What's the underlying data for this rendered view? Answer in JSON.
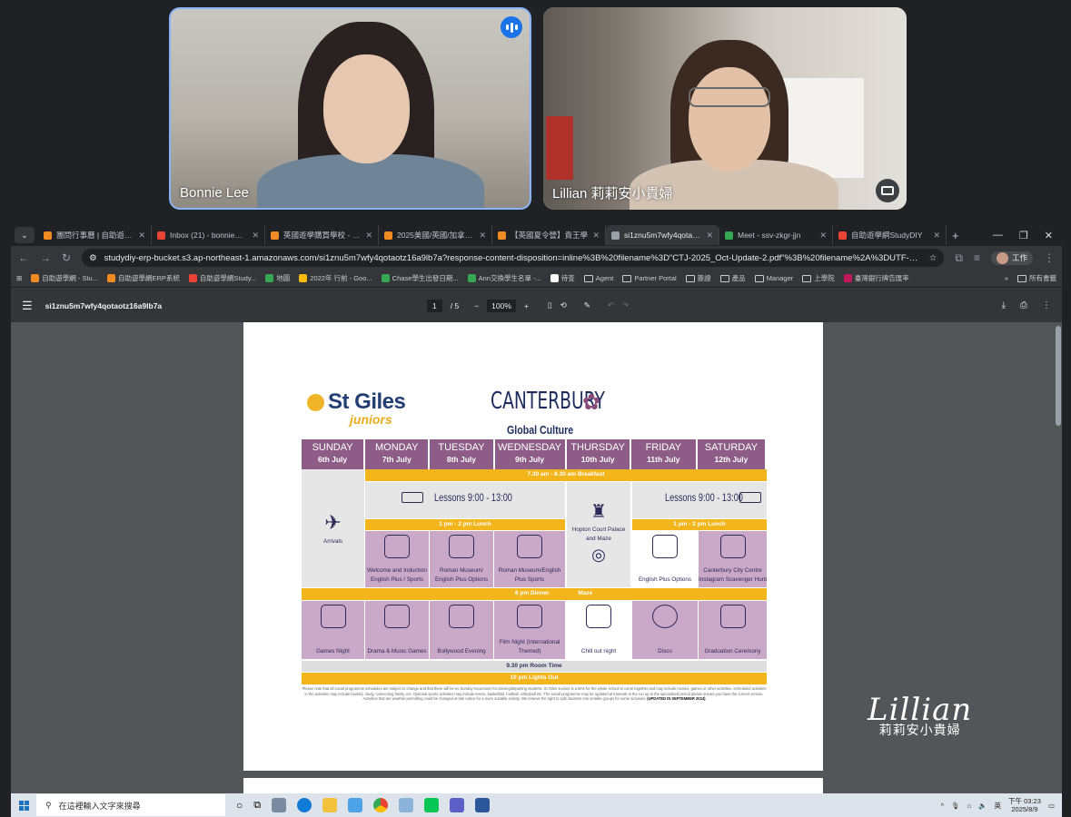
{
  "meeting": {
    "participants": [
      {
        "name": "Bonnie Lee"
      },
      {
        "name": "Lillian 莉莉安小貴婦"
      }
    ]
  },
  "browser": {
    "tabs": [
      {
        "label": "團問行事曆 | 自助遊學網",
        "color": "#f28b22"
      },
      {
        "label": "Inbox (21) - bonnie@stu",
        "color": "#ea4335"
      },
      {
        "label": "英國遊學購買學校 - Study",
        "color": "#f28b22"
      },
      {
        "label": "2025美國/英國/加拿大/遊",
        "color": "#f28b22"
      },
      {
        "label": "【英國夏令營】貴王學",
        "color": "#f28b22"
      },
      {
        "label": "si1znu5m7wfy4qotaotz",
        "color": "#9aa0a6",
        "active": true
      },
      {
        "label": "Meet - ssv-zkgr-jjn",
        "color": "#34a853"
      },
      {
        "label": "自助遊學網StudyDIY",
        "color": "#ea4335"
      }
    ],
    "url": "studydiy-erp-bucket.s3.ap-northeast-1.amazonaws.com/si1znu5m7wfy4qotaotz16a9lb7a?response-content-disposition=inline%3B%20filename%3D\"CTJ-2025_Oct-Update-2.pdf\"%3B%20filename%2A%3DUTF-8%27%27CTJ-2...",
    "profile_label": "工作",
    "bookmarks": [
      {
        "label": "自助遊學網 - Stu...",
        "kind": "site",
        "color": "#f28b22"
      },
      {
        "label": "自助遊學網ERP系統",
        "kind": "site",
        "color": "#f28b22"
      },
      {
        "label": "自助遊學網Study...",
        "kind": "site",
        "color": "#ea4335"
      },
      {
        "label": "地圖",
        "kind": "site",
        "color": "#34a853"
      },
      {
        "label": "2022年 行前 - Goo...",
        "kind": "site",
        "color": "#fbbc04"
      },
      {
        "label": "Chase學生出發日期...",
        "kind": "site",
        "color": "#34a853"
      },
      {
        "label": "Ann交換學生名單 -...",
        "kind": "site",
        "color": "#34a853"
      },
      {
        "label": "待查",
        "kind": "site",
        "color": "#ffffff"
      },
      {
        "label": "Agent",
        "kind": "folder"
      },
      {
        "label": "Partner Portal",
        "kind": "folder"
      },
      {
        "label": "簽證",
        "kind": "folder"
      },
      {
        "label": "產品",
        "kind": "folder"
      },
      {
        "label": "Manager",
        "kind": "folder"
      },
      {
        "label": "上學院",
        "kind": "folder"
      },
      {
        "label": "臺灣銀行牌告匯率",
        "kind": "site",
        "color": "#c2185b"
      }
    ],
    "all_bookmarks": "所有書籤"
  },
  "pdf": {
    "filename": "si1znu5m7wfy4qotaotz16a9lb7a",
    "current_page": "1",
    "total_pages": "/ 5",
    "zoom": "100%",
    "schedule": {
      "brand": "St Giles",
      "brand_sub": "juniors",
      "city": "CANTERBURY",
      "theme": "Global Culture",
      "days": [
        {
          "name": "SUNDAY",
          "date": "6th July"
        },
        {
          "name": "MONDAY",
          "date": "7th July"
        },
        {
          "name": "TUESDAY",
          "date": "8th July"
        },
        {
          "name": "WEDNESDAY",
          "date": "9th July"
        },
        {
          "name": "THURSDAY",
          "date": "10th July"
        },
        {
          "name": "FRIDAY",
          "date": "11th July"
        },
        {
          "name": "SATURDAY",
          "date": "12th July"
        }
      ],
      "breakfast": "7.30 am - 8.30 am  Breakfast",
      "arrivals": "Arrivals",
      "lessons_1": "Lessons 9:00 - 13:00",
      "lessons_2": "Lessons 9:00 - 13:00",
      "thursday_trip": "Hopton Court Palace and Maze",
      "lunch_1": "1 pm - 2 pm  Lunch",
      "lunch_2": "1 pm - 2 pm  Lunch",
      "afternoon": [
        "Welcome and Induction English Plus / Sports",
        "Roman Museum/ English Plus Options",
        "Roman Museum/English Plus Sports",
        "English Plus Options",
        "Canterbury City Centre Instagram Scavenger Hunt"
      ],
      "dinner": "6 pm Dinner",
      "dinner_note": "Maze",
      "evening": [
        "Games Night",
        "Drama & Music Games",
        "Bollywood Evening",
        "Film Night (International Themed)",
        "Chill out night",
        "Disco",
        "Graduation Ceremony"
      ],
      "room_time": "9.30 pm  Room Time",
      "lights_out": "10 pm  Lights Out",
      "fine_print": "Please note that all social programme schedules are subject to change and that there will be no Sunday excursions for arriving/departing students. St Giles Juniors is a time for the whole school to come together and may include movies, games or other activities. Scheduled activities in the activities may include laundry, study, connecting family, etc. Optional sports activities may include tennis, basketball, football, volleyball etc. The social programme may be updated at intervals in the run up to the specialized period please ensure you have the current version. Activities that are weather permitting could be changed at late notice for a more suitable activity. We reserve the right to split students into smaller groups for some activities.",
      "updated": "(UPDATED IN SEPTEMBER 2024)"
    }
  },
  "watermark": {
    "script": "Lillian",
    "chinese": "莉莉安小貴婦"
  },
  "taskbar": {
    "search_placeholder": "在這裡輸入文字來搜尋",
    "time": "下午 03:23",
    "date": "2025/8/9"
  }
}
